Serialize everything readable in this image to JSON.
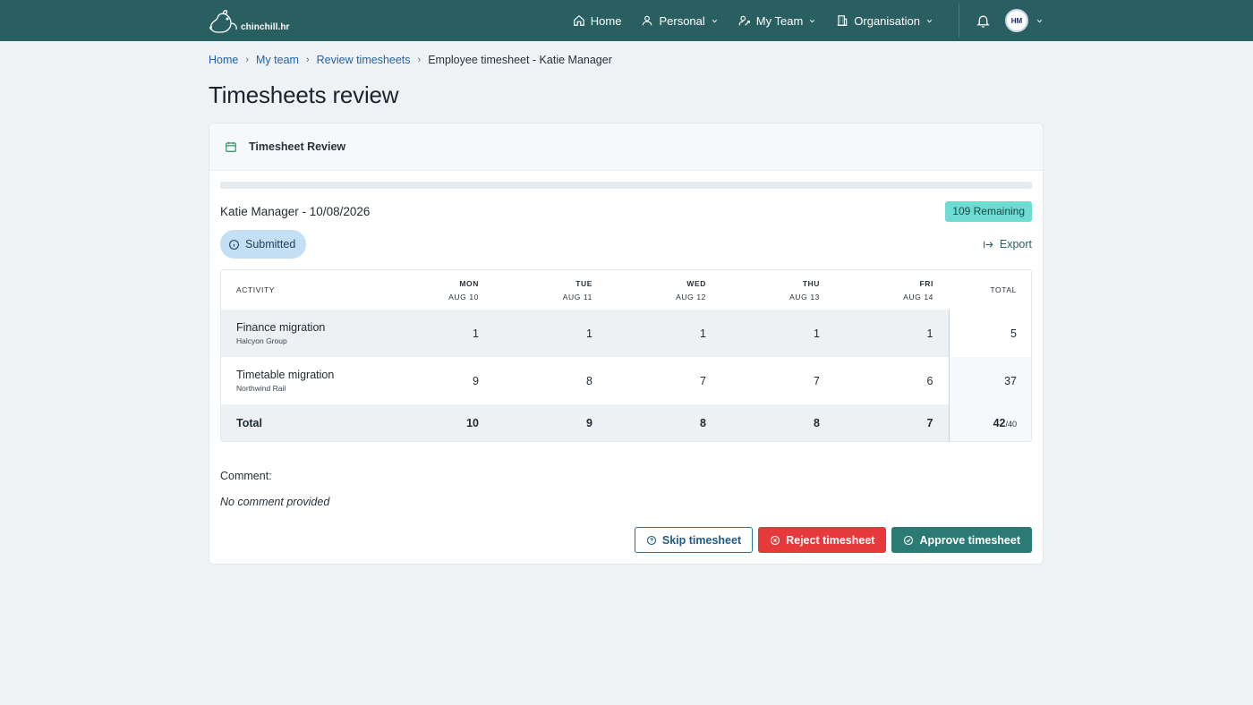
{
  "brand": {
    "name": "chinchill.hr"
  },
  "nav": {
    "items": [
      {
        "label": "Home",
        "icon": "home-icon"
      },
      {
        "label": "Personal",
        "icon": "user-icon"
      },
      {
        "label": "My Team",
        "icon": "team-icon"
      },
      {
        "label": "Organisation",
        "icon": "building-icon"
      }
    ],
    "avatar_initials": "HM"
  },
  "breadcrumb": {
    "items": [
      "Home",
      "My team",
      "Review timesheets"
    ],
    "current": "Employee timesheet - Katie Manager"
  },
  "page": {
    "title": "Timesheets review"
  },
  "card": {
    "title": "Timesheet Review",
    "employee_line": "Katie Manager - 10/08/2026",
    "remaining": "109 Remaining",
    "status": "Submitted",
    "export_label": "Export"
  },
  "table": {
    "activity_header": "ACTIVITY",
    "total_header": "TOTAL",
    "days": [
      {
        "day": "MON",
        "date": "AUG 10"
      },
      {
        "day": "TUE",
        "date": "AUG 11"
      },
      {
        "day": "WED",
        "date": "AUG 12"
      },
      {
        "day": "THU",
        "date": "AUG 13"
      },
      {
        "day": "FRI",
        "date": "AUG 14"
      }
    ],
    "rows": [
      {
        "activity": "Finance migration",
        "client": "Halcyon Group",
        "hours": [
          "1",
          "1",
          "1",
          "1",
          "1"
        ],
        "total": "5"
      },
      {
        "activity": "Timetable migration",
        "client": "Northwind Rail",
        "hours": [
          "9",
          "8",
          "7",
          "7",
          "6"
        ],
        "total": "37"
      }
    ],
    "totals": {
      "label": "Total",
      "hours": [
        "10",
        "9",
        "8",
        "8",
        "7"
      ],
      "total": "42",
      "target": "/40"
    }
  },
  "comment": {
    "label": "Comment:",
    "text": "No comment provided"
  },
  "actions": {
    "skip": "Skip timesheet",
    "reject": "Reject timesheet",
    "approve": "Approve timesheet"
  },
  "colors": {
    "topbar": "#2a5f62",
    "remaining_badge": "#6fdcd3",
    "status_pill": "#c4dff4",
    "reject": "#e5393c",
    "approve": "#2b7a74"
  }
}
